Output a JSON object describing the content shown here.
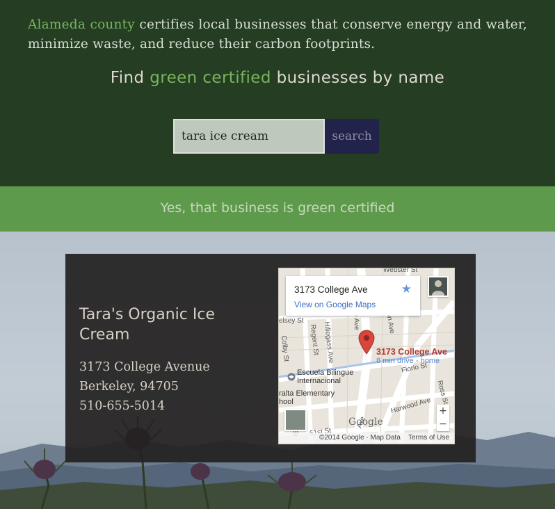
{
  "intro": {
    "accent": "Alameda county",
    "text": " certifies local businesses that conserve energy and water, minimize waste, and reduce their carbon footprints."
  },
  "headline": {
    "before": "Find ",
    "accent": "green certified",
    "after": " businesses by name"
  },
  "search": {
    "value": "tara ice cream",
    "button_label": "search"
  },
  "result_banner": "Yes, that business is green certified",
  "business": {
    "name": "Tara's Organic Ice Cream",
    "street": "3173 College Avenue",
    "city": "Berkeley, 94705",
    "phone": "510-655-5014"
  },
  "map": {
    "info_title": "3173 College Ave",
    "info_link": "View on Google Maps",
    "star_icon": "star-icon",
    "pin_label": "3173 College Ave",
    "pin_sub": "8 min drive - home",
    "logo": "Google",
    "copyright": "©2014 Google · Map Data",
    "terms": "Terms of Use",
    "zoom_in": "+",
    "zoom_out": "−",
    "streets": {
      "webster": "Webster St",
      "elsey": "elsey St",
      "colby": "Colby St",
      "regent": "Regent St",
      "hillegass": "Hillegass Ave",
      "college": "ge Ave",
      "elton": "lton Ave",
      "florio": "Florio St",
      "ross": "Ross St",
      "harwood": "Harwood Ave",
      "61st": "61st St",
      "ave_bottom": "Ave",
      "st_left": "St"
    },
    "pois": {
      "school1": "Escuela Bilingue",
      "school1b": "Internacional",
      "school2": "ralta Elementary",
      "school2b": "hool"
    }
  },
  "colors": {
    "hero_bg": "#243d23",
    "accent_green": "#7bb35e",
    "banner_bg": "#5e9a4c",
    "search_button_bg": "#22234a",
    "card_bg": "#232121",
    "pin_red": "#d6463a"
  }
}
